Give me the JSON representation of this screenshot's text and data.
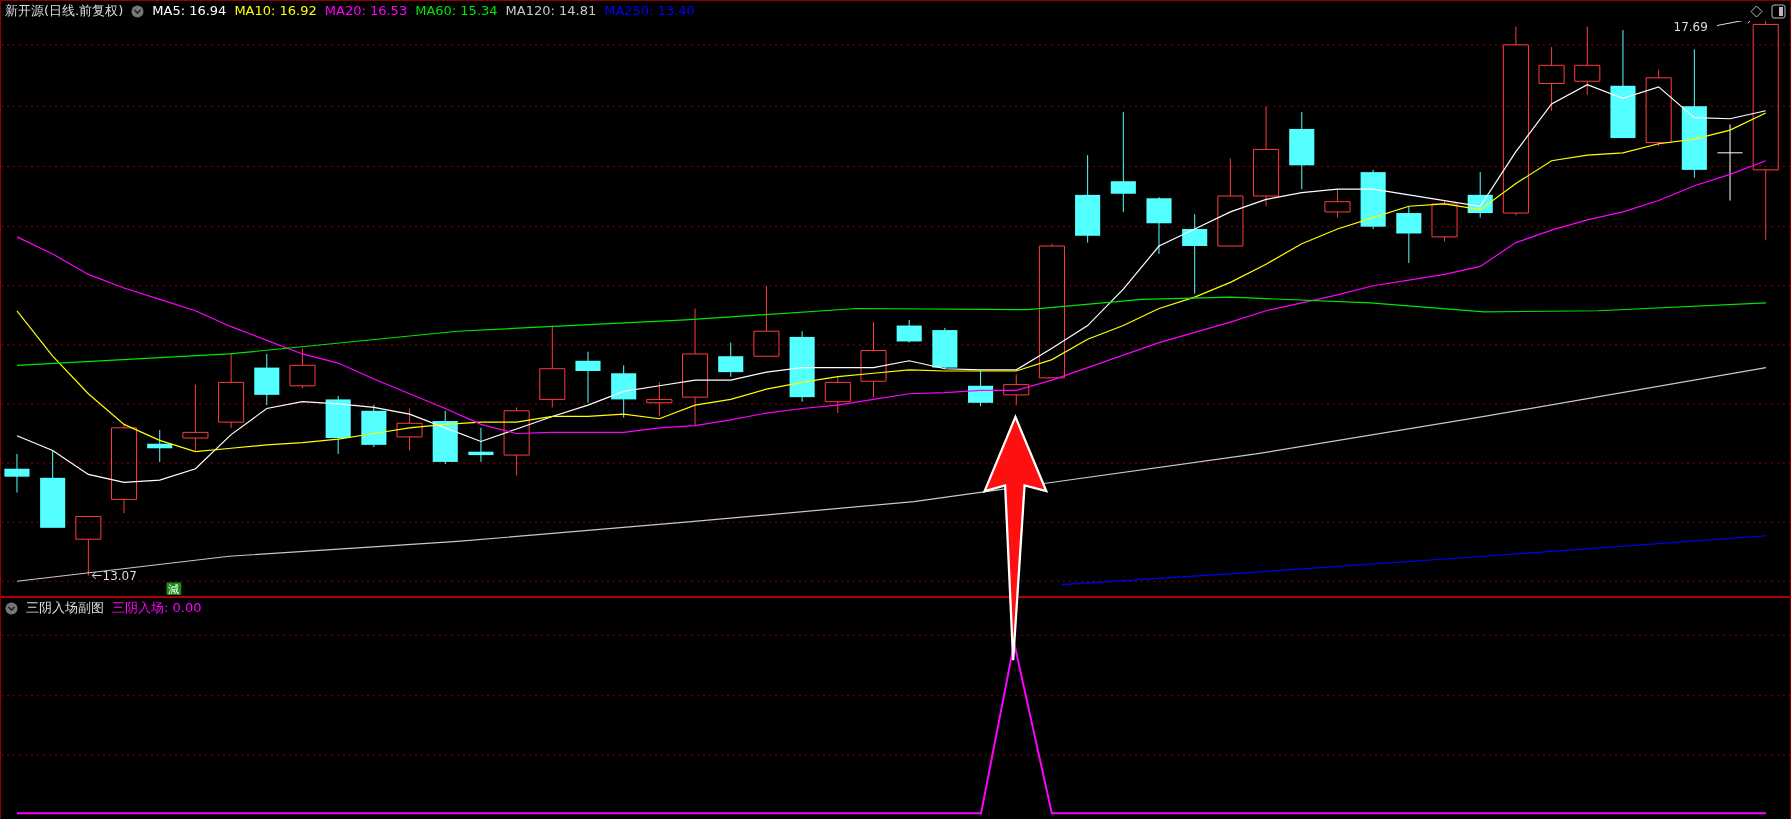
{
  "header": {
    "title": "新开源(日线.前复权)",
    "ma_legend": [
      {
        "label": "MA5: 16.94",
        "color": "#ffffff"
      },
      {
        "label": "MA10: 16.92",
        "color": "#ffff00"
      },
      {
        "label": "MA20: 16.53",
        "color": "#ff00ff"
      },
      {
        "label": "MA60: 15.34",
        "color": "#00e600"
      },
      {
        "label": "MA120: 14.81",
        "color": "#c8c8c8"
      },
      {
        "label": "MA250: 13.40",
        "color": "#0000ff"
      }
    ]
  },
  "main_chart": {
    "high_label": "17.69",
    "low_label": "13.07",
    "signal_badge": "減"
  },
  "sub_panel": {
    "title": "三阴入场副图",
    "reading": "三阴入场: 0.00"
  }
}
